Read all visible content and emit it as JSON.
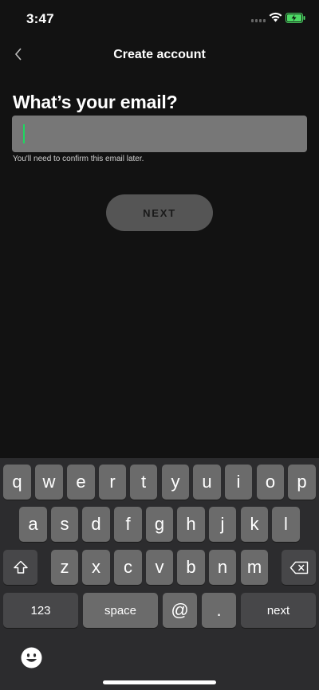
{
  "status_bar": {
    "time": "3:47"
  },
  "header": {
    "title": "Create account",
    "back_icon": "chevron-left-icon"
  },
  "form": {
    "question": "What’s your email?",
    "email_value": "",
    "hint": "You'll need to confirm this email later.",
    "next_label": "NEXT"
  },
  "colors": {
    "background": "#121212",
    "accent": "#1ed760",
    "field": "#777777",
    "button": "#555555"
  },
  "keyboard": {
    "row1": [
      "q",
      "w",
      "e",
      "r",
      "t",
      "y",
      "u",
      "i",
      "o",
      "p"
    ],
    "row2": [
      "a",
      "s",
      "d",
      "f",
      "g",
      "h",
      "j",
      "k",
      "l"
    ],
    "row3": [
      "z",
      "x",
      "c",
      "v",
      "b",
      "n",
      "m"
    ],
    "numbers_label": "123",
    "space_label": "space",
    "at_label": "@",
    "dot_label": ".",
    "next_label": "next"
  }
}
